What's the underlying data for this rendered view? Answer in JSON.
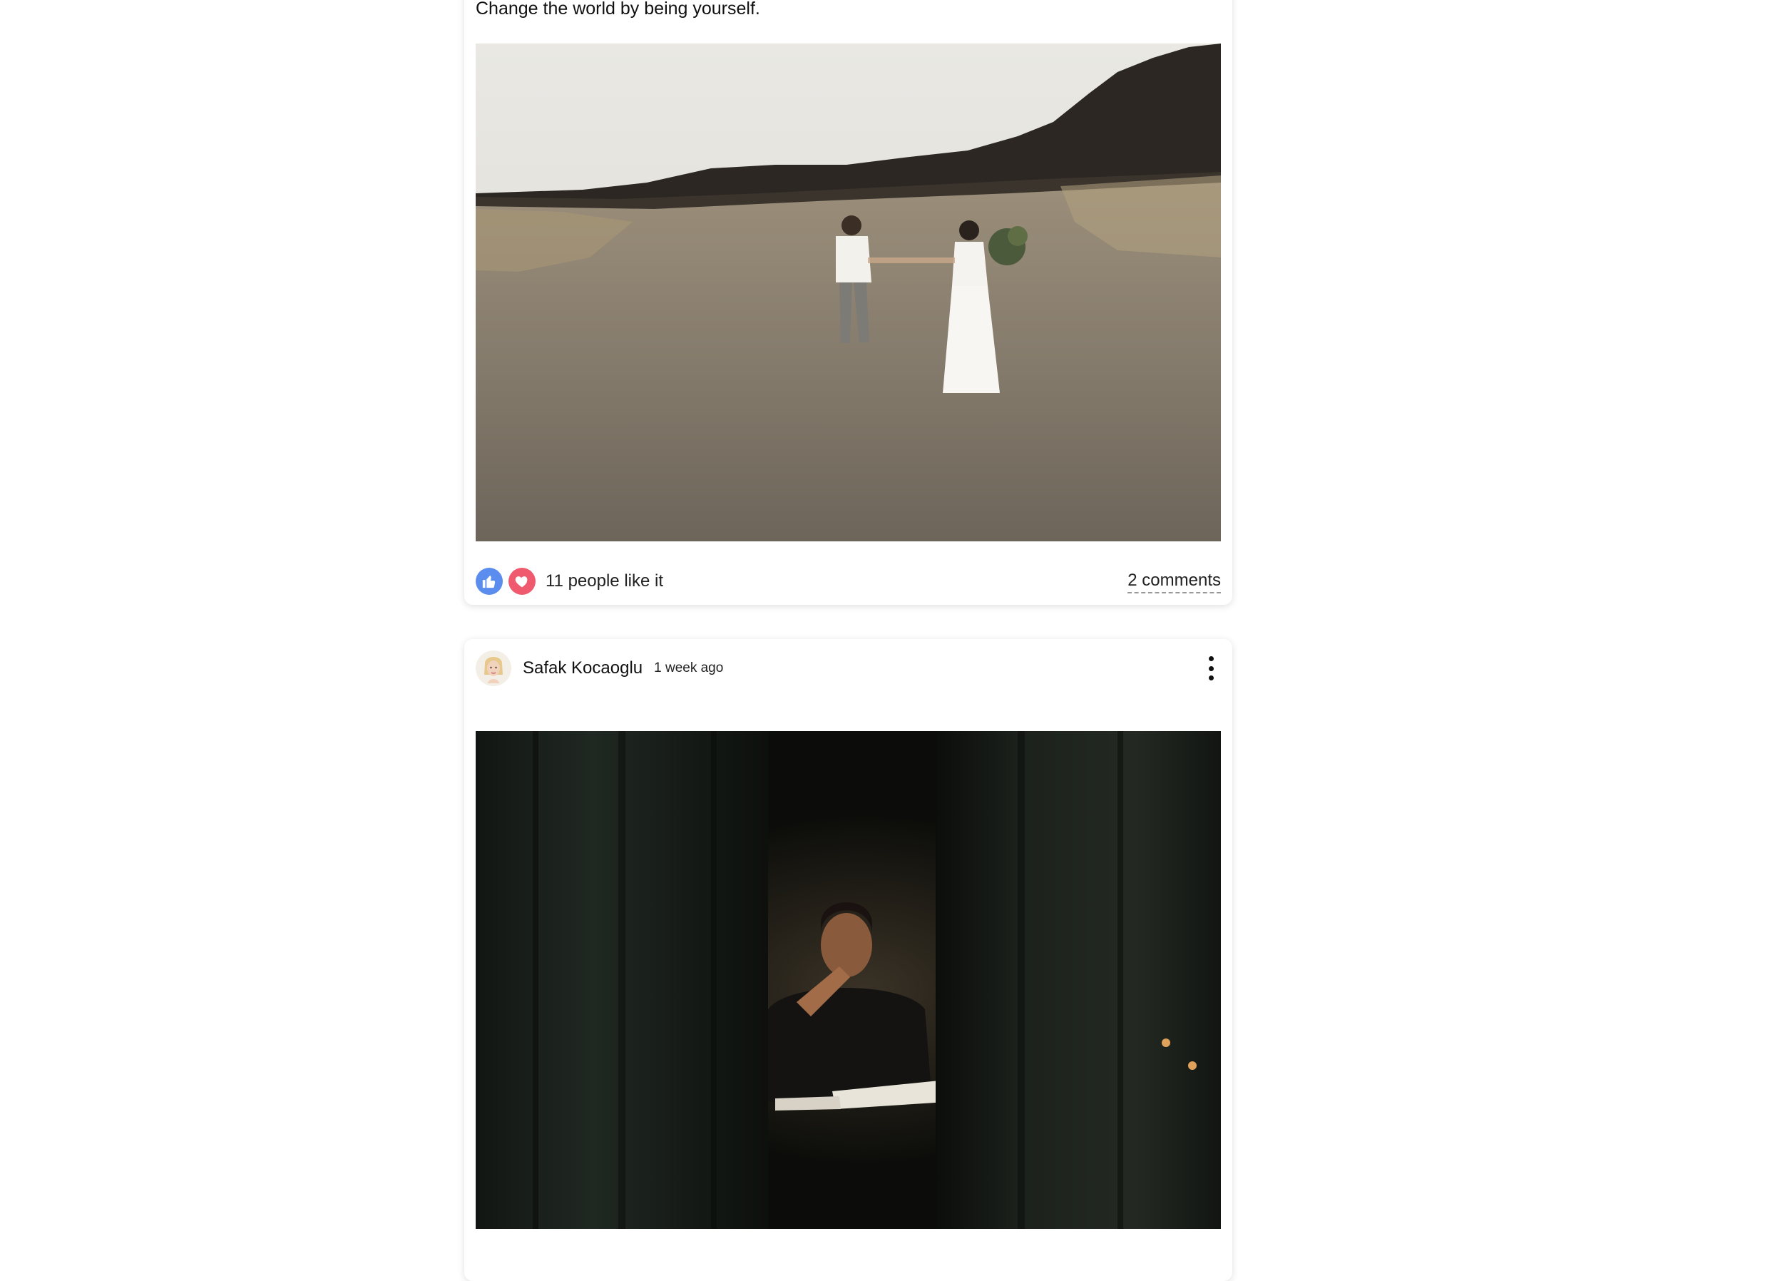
{
  "posts": [
    {
      "caption": "Change the world by being yourself.",
      "image": "couple-walking-in-desert-photo",
      "likes_text": "11 people like it",
      "comments_text": "2 comments"
    },
    {
      "author": "Safak Kocaoglu",
      "time": "1 week ago",
      "image": "man-reading-by-window-photo"
    }
  ],
  "colors": {
    "like": "#5b8def",
    "love": "#ef5a6e"
  },
  "icons": {
    "like": "thumbs-up-icon",
    "love": "heart-icon",
    "menu": "more-vertical-icon"
  }
}
